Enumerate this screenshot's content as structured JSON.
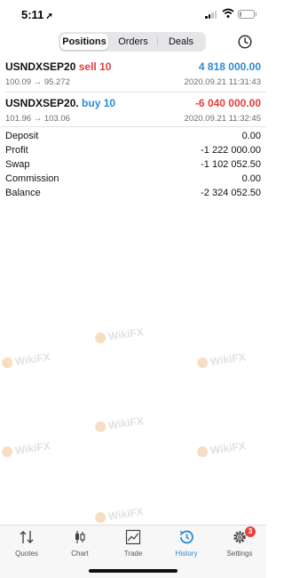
{
  "status_bar": {
    "time": "5:11",
    "location_arrow": "➚"
  },
  "tabs": [
    {
      "label": "Positions",
      "active": true
    },
    {
      "label": "Orders",
      "active": false
    },
    {
      "label": "Deals",
      "active": false
    }
  ],
  "positions": [
    {
      "symbol": "USNDXSEP20",
      "type": "sell 10",
      "side": "sell",
      "prices": "100.09 → 95.272",
      "profit": "4 818 000.00",
      "date": "2020.09.21 11:31:43"
    },
    {
      "symbol": "USNDXSEP20.",
      "type": "buy 10",
      "side": "buy",
      "prices": "101.96 → 103.06",
      "profit": "-6 040 000.00",
      "date": "2020.09.21 11:32:45"
    }
  ],
  "summary": [
    {
      "label": "Deposit",
      "value": "0.00"
    },
    {
      "label": "Profit",
      "value": "-1 222 000.00"
    },
    {
      "label": "Swap",
      "value": "-1 102 052.50"
    },
    {
      "label": "Commission",
      "value": "0.00"
    },
    {
      "label": "Balance",
      "value": "-2 324 052.50"
    }
  ],
  "watermark": "WikiFX",
  "nav": [
    {
      "label": "Quotes",
      "icon": "quotes-icon"
    },
    {
      "label": "Chart",
      "icon": "chart-icon"
    },
    {
      "label": "Trade",
      "icon": "trade-icon"
    },
    {
      "label": "History",
      "icon": "history-icon",
      "active": true
    },
    {
      "label": "Settings",
      "icon": "settings-icon",
      "badge": "3"
    }
  ],
  "colors": {
    "accent": "#2a8ad4",
    "negative": "#e0403a",
    "badge": "#e8413a"
  }
}
